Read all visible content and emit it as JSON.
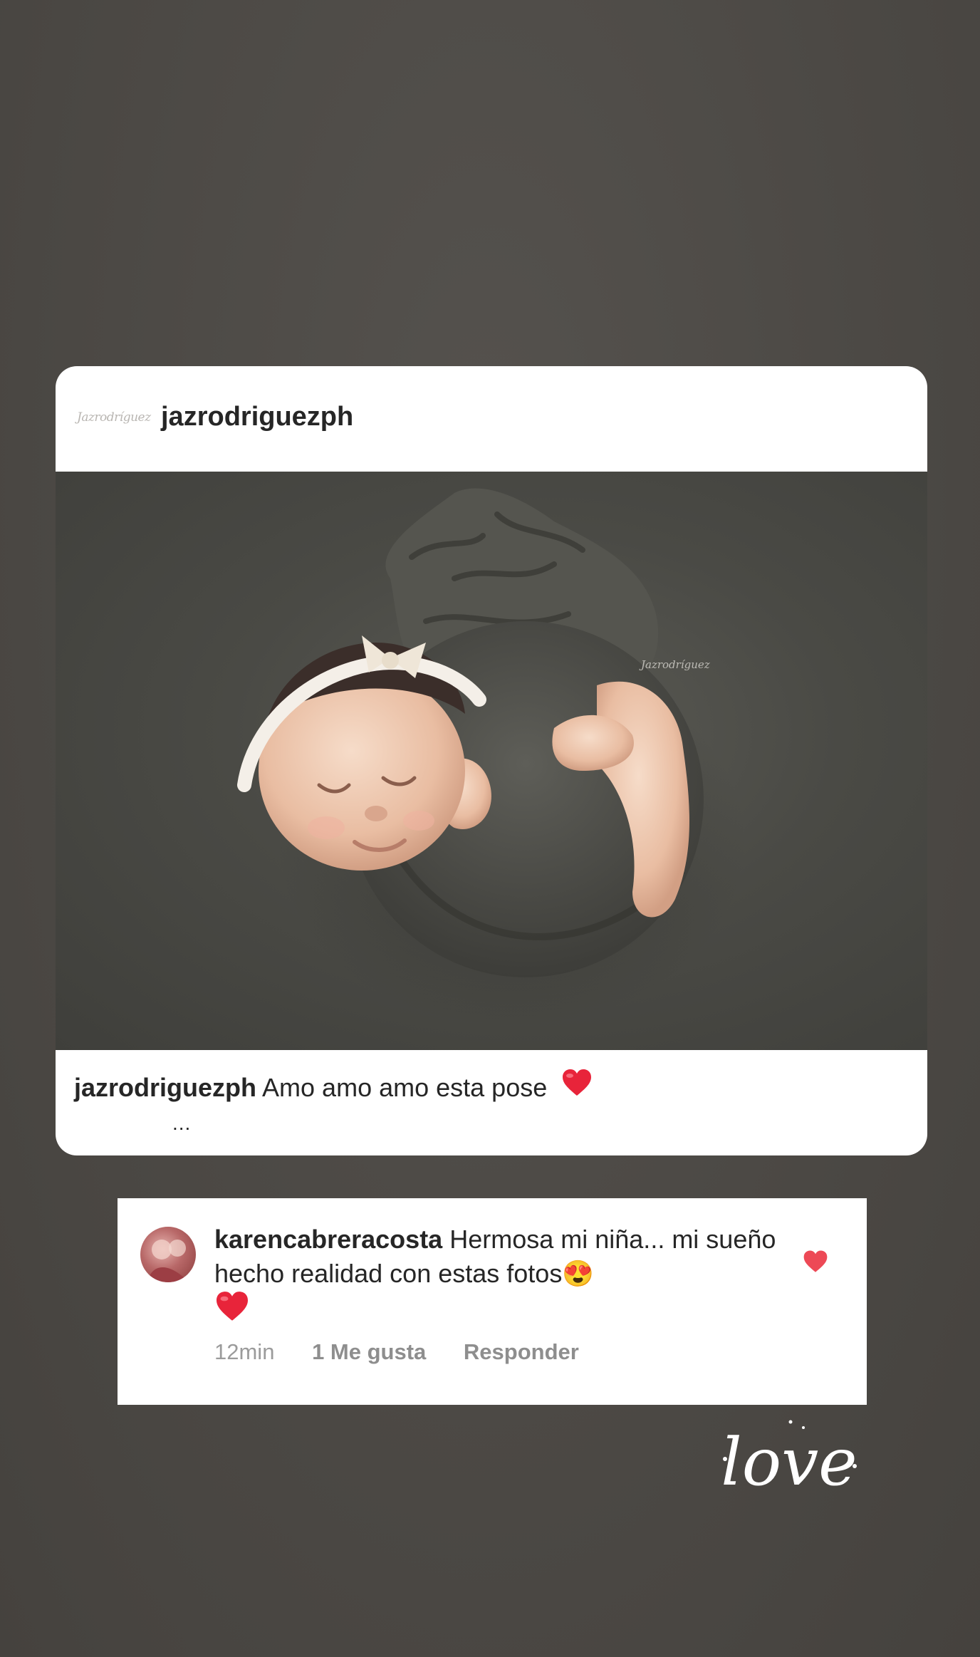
{
  "post": {
    "username": "jazrodriguezph",
    "logo_text": "Jazrodríguez",
    "caption_user": "jazrodriguezph",
    "caption_text": "Amo amo amo esta pose",
    "more": "...",
    "photo_watermark": "Jazrodríguez"
  },
  "comment": {
    "username": "karencabreracosta",
    "text": "Hermosa mi niña... mi sueño hecho realidad con estas fotos😍",
    "time": "12min",
    "likes_label": "1 Me gusta",
    "reply_label": "Responder"
  },
  "sticker": {
    "text": "love"
  },
  "colors": {
    "background": "#4e4b47",
    "card": "#ffffff",
    "heart": "#e8243a",
    "meta_text": "#9b9b9b"
  },
  "icons": {
    "caption_emoji": "red-heart-icon",
    "comment_emoji": "heart-eyes-emoji-icon",
    "comment_like": "heart-icon"
  }
}
